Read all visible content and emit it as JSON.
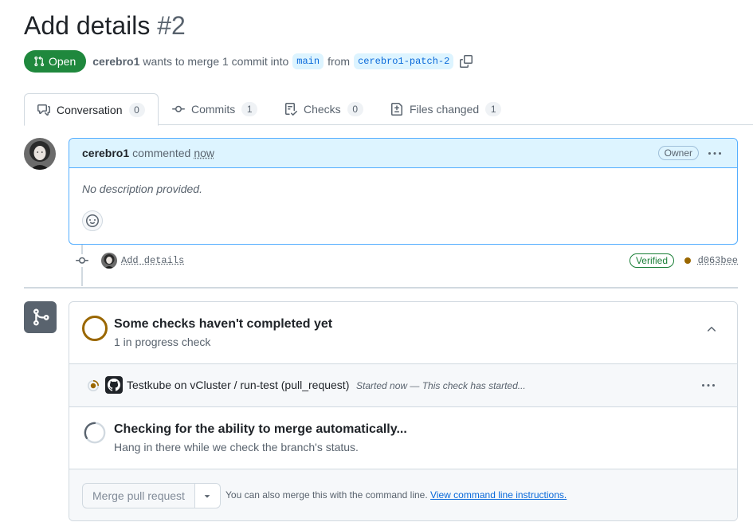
{
  "pr": {
    "title": "Add details",
    "number": "#2",
    "state": "Open",
    "author": "cerebro1",
    "merge_text": "wants to merge 1 commit into",
    "base_branch": "main",
    "from_text": "from",
    "head_branch": "cerebro1-patch-2"
  },
  "tabs": [
    {
      "label": "Conversation",
      "count": "0"
    },
    {
      "label": "Commits",
      "count": "1"
    },
    {
      "label": "Checks",
      "count": "0"
    },
    {
      "label": "Files changed",
      "count": "1"
    }
  ],
  "comment": {
    "author": "cerebro1",
    "action": "commented",
    "time": "now",
    "role": "Owner",
    "body": "No description provided."
  },
  "commit": {
    "message": "Add details",
    "verified": "Verified",
    "sha": "d063bee"
  },
  "checks": {
    "title": "Some checks haven't completed yet",
    "subtitle": "1 in progress check",
    "run_name": "Testkube on vCluster / run-test (pull_request)",
    "run_desc": "Started now — This check has started..."
  },
  "mergeability": {
    "title": "Checking for the ability to merge automatically...",
    "subtitle": "Hang in there while we check the branch's status."
  },
  "merge": {
    "button": "Merge pull request",
    "note": "You can also merge this with the command line.",
    "link": "View command line instructions."
  },
  "colors": {
    "open_green": "#1f883d",
    "link_blue": "#0969da",
    "pending_yellow": "#9a6700",
    "comment_border": "#54aeff",
    "comment_header_bg": "#ddf4ff"
  },
  "icons": {
    "state": "git-pull-request-icon",
    "copy": "copy-icon",
    "conversation": "comment-discussion-icon",
    "commits": "git-commit-icon",
    "checks": "checklist-icon",
    "files": "file-diff-icon",
    "more": "kebab-horizontal-icon",
    "emoji": "smiley-icon",
    "merge": "git-merge-icon",
    "collapse": "chevron-up-icon",
    "dropdown": "triangle-down-icon"
  }
}
